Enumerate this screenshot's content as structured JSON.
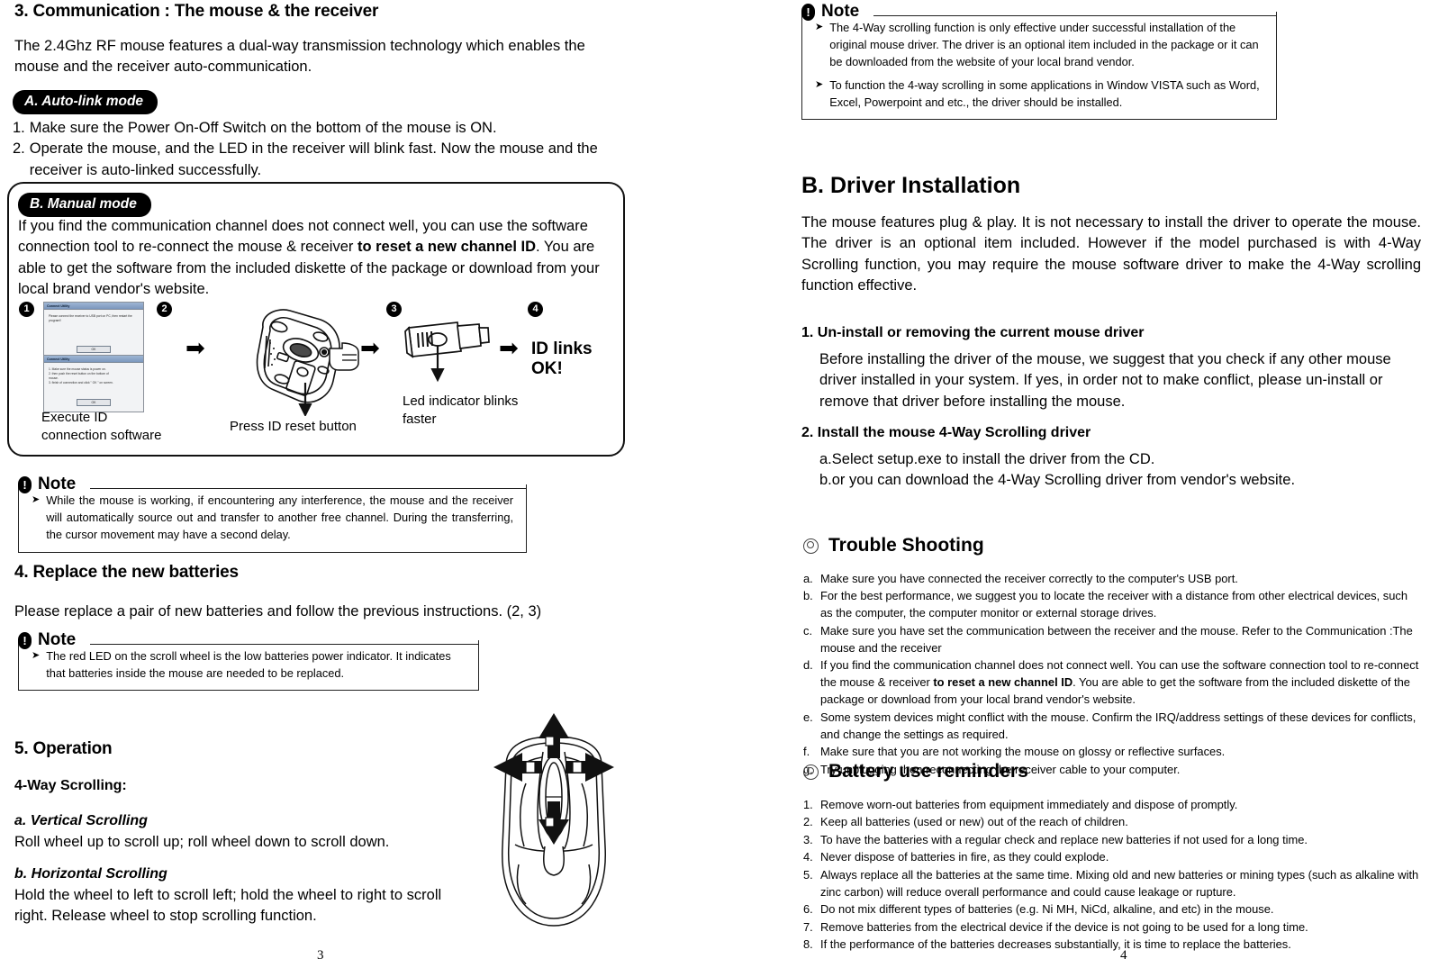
{
  "left_page": {
    "page_number": "3",
    "section3": {
      "heading": "3. Communication : The mouse & the receiver",
      "intro": "The 2.4Ghz RF mouse features a dual-way transmission technology which enables the mouse and the receiver auto-communication.",
      "auto_link": {
        "pill": "A. Auto-link mode",
        "items": [
          {
            "n": "1.",
            "t": "Make sure the Power On-Off Switch on the bottom of the mouse is ON."
          },
          {
            "n": "2.",
            "t": "Operate the mouse, and the LED in the receiver will blink fast. Now the mouse and the receiver is auto-linked successfully."
          }
        ]
      },
      "manual": {
        "pill": "B. Manual mode",
        "text_part1": "If you find the communication channel does not connect well, you can use the software connection tool to re-connect the mouse & receiver ",
        "text_bold": "to reset a new channel ID",
        "text_part2": ".   You are able to get the software from the included diskette of the package or download from your local brand vendor's website.",
        "steps": {
          "n1": "1",
          "n2": "2",
          "n3": "3",
          "n4": "4",
          "dialog1": {
            "title": "Connect Utility",
            "body": "Please connect the receiver to USB port on PC, then restart the program!!",
            "ok": "OK"
          },
          "dialog2": {
            "title": "Connect Utility",
            "body_lines": [
              "1. Make sure the mouse status is power on.",
              "2. then push the reset button on the bottom of",
              "mouse.",
              "3. finish of connection and click \" OK \" on screen."
            ],
            "ok": "OK"
          },
          "caption1": "Execute ID connection software",
          "caption2": "Press ID reset button",
          "caption3": "Led indicator blinks faster",
          "caption4": "ID links OK!",
          "arrow": "➡"
        }
      },
      "note": {
        "title": "Note",
        "icon": "!",
        "items": [
          "While the mouse is working, if encountering any interference, the mouse and the receiver will automatically source out and transfer to another free channel.  During the transferring, the cursor movement may have a second delay."
        ]
      }
    },
    "section4": {
      "heading": "4. Replace the new batteries",
      "text": "Please replace a pair of new batteries and follow the previous instructions. (2, 3)",
      "note": {
        "title": "Note",
        "icon": "!",
        "items": [
          "The red LED on the scroll wheel is the low batteries power indicator.  It indicates that batteries inside the mouse are needed to be replaced."
        ]
      }
    },
    "section5": {
      "heading": "5. Operation",
      "subheading": "4-Way Scrolling:",
      "a_title": "a. Vertical Scrolling",
      "a_text": "Roll wheel up to scroll up; roll wheel down to scroll down.",
      "b_title": "b. Horizontal Scrolling",
      "b_text": "Hold the wheel to left to scroll left; hold the wheel to right to scroll right. Release wheel to stop scrolling function."
    }
  },
  "right_page": {
    "page_number": "4",
    "note": {
      "title": "Note",
      "icon": "!",
      "items": [
        "The 4-Way scrolling function is only effective under successful installation of the original mouse driver. The driver is an optional item included in the package or it can be downloaded from the website of your local brand vendor.",
        "To function the 4-way scrolling in some applications in Window VISTA such as Word, Excel, Powerpoint and etc., the driver should be installed."
      ]
    },
    "driver_install": {
      "heading": "B. Driver Installation",
      "intro": "The mouse features plug & play. It is not necessary to install the driver to operate the mouse. The driver is an optional item included. However if the model purchased is with 4-Way Scrolling function, you may require the mouse software driver to make the 4-Way scrolling function effective.",
      "step1_title": "1. Un-install or removing the current mouse driver",
      "step1_text": "Before installing the driver of the mouse, we suggest that you check if any other mouse driver installed in your system. If yes, in order not to make conflict, please un-install or remove that driver before installing the mouse.",
      "step2_title": "2. Install the mouse 4-Way Scrolling driver",
      "step2_a": "a.Select setup.exe to install the driver from the CD.",
      "step2_b": "b.or you can download the 4-Way Scrolling driver from vendor's website."
    },
    "trouble": {
      "heading": "Trouble Shooting",
      "items": [
        {
          "k": "a.",
          "v": "Make sure you have connected the receiver correctly to the computer's USB port."
        },
        {
          "k": "b.",
          "v": "For the best performance, we suggest you to locate the receiver with a distance from other electrical devices, such as the computer, the computer monitor or external storage drives."
        },
        {
          "k": "c.",
          "v": "Make sure you have set the communication between the receiver and the mouse. Refer to the Communication :The mouse and the receiver"
        },
        {
          "k": "d.",
          "v": "If you find the communication channel does not connect well.  You can use the software connection tool to re-connect the mouse & receiver to reset a new channel ID.  You are able to get the software from the included diskette of the package or download from your local brand vendor's website."
        },
        {
          "k": "e.",
          "v": "Some system devices might conflict with the mouse.  Confirm the IRQ/address settings of these devices for conflicts, and change the settings as required."
        },
        {
          "k": "f.",
          "v": "Make sure that you are not working the mouse on glossy or reflective surfaces."
        },
        {
          "k": "g.",
          "v": "Try unplugging then reconnecting the receiver cable to your computer."
        }
      ],
      "item_d_bold": "to reset a new channel ID"
    },
    "battery": {
      "heading": "Battery use reminders",
      "items": [
        {
          "k": "1.",
          "v": "Remove worn-out batteries from equipment immediately and dispose of promptly."
        },
        {
          "k": "2.",
          "v": "Keep all batteries (used or new) out of the reach of children."
        },
        {
          "k": "3.",
          "v": "To have the batteries with a regular check and replace new batteries if not used for a long time."
        },
        {
          "k": "4.",
          "v": "Never dispose of batteries in fire, as they could explode."
        },
        {
          "k": "5.",
          "v": "Always replace all the batteries at the same time.  Mixing old and new batteries or mining types (such as alkaline with zinc carbon) will reduce overall performance and could cause leakage or rupture."
        },
        {
          "k": "6.",
          "v": "Do not mix different types of batteries (e.g. Ni MH, NiCd, alkaline, and etc) in the mouse."
        },
        {
          "k": "7.",
          "v": "Remove batteries from the electrical device if the device is not going to be used for a long time."
        },
        {
          "k": "8.",
          "v": "If the performance of the batteries decreases substantially, it is time to replace the batteries."
        }
      ]
    }
  }
}
